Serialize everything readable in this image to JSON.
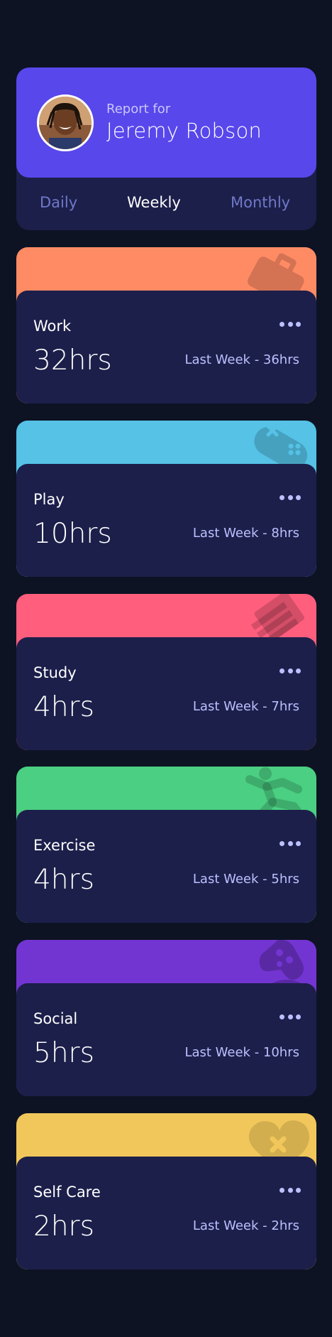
{
  "profile": {
    "report_for": "Report for",
    "name": "Jeremy Robson"
  },
  "tabs": [
    {
      "label": "Daily",
      "active": false
    },
    {
      "label": "Weekly",
      "active": true
    },
    {
      "label": "Monthly",
      "active": false
    }
  ],
  "activities": [
    {
      "title": "Work",
      "current": "32hrs",
      "previous": "Last Week - 36hrs",
      "color": "#ff8b64",
      "icon": "briefcase-icon"
    },
    {
      "title": "Play",
      "current": "10hrs",
      "previous": "Last Week - 8hrs",
      "color": "#55c2e6",
      "icon": "gamepad-icon"
    },
    {
      "title": "Study",
      "current": "4hrs",
      "previous": "Last Week - 7hrs",
      "color": "#ff5e7d",
      "icon": "book-icon"
    },
    {
      "title": "Exercise",
      "current": "4hrs",
      "previous": "Last Week - 5hrs",
      "color": "#4bcf82",
      "icon": "running-icon"
    },
    {
      "title": "Social",
      "current": "5hrs",
      "previous": "Last Week - 10hrs",
      "color": "#7335d2",
      "icon": "social-icon"
    },
    {
      "title": "Self Care",
      "current": "2hrs",
      "previous": "Last Week - 2hrs",
      "color": "#f1c75b",
      "icon": "heart-icon"
    }
  ],
  "colors": {
    "background": "#0d1323",
    "card": "#1c1f4a",
    "accent": "#5847eb",
    "muted_text": "#bbc0ff",
    "inactive_tab": "#7078c9"
  }
}
